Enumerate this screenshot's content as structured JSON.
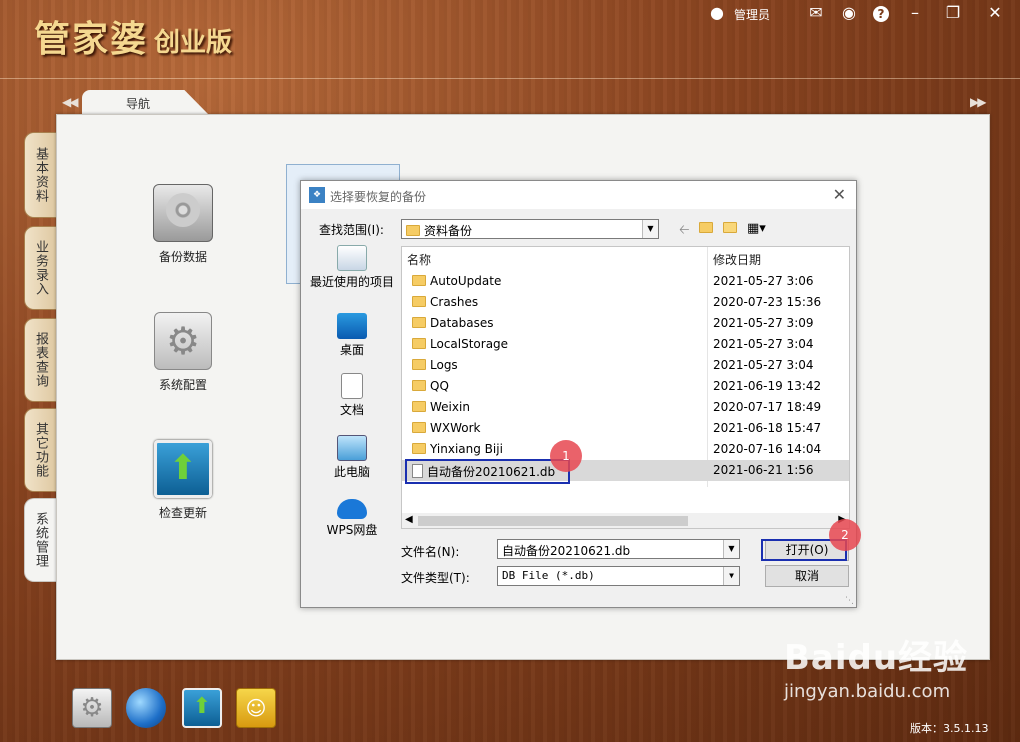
{
  "app": {
    "brand": "管家婆",
    "edition": "创业版",
    "admin_label": "管理员",
    "version": "版本：3.5.1.13"
  },
  "header_icons": [
    "user-icon",
    "mail-icon",
    "weibo-icon",
    "help-icon",
    "minimize-icon",
    "restore-icon",
    "close-icon"
  ],
  "nav_tab": "导航",
  "side_tabs": [
    "基本资料",
    "业务录入",
    "报表查询",
    "其它功能",
    "系统管理"
  ],
  "active_side_tab": "系统管理",
  "nav_items": [
    "备份数据",
    "系统配置",
    "检查更新"
  ],
  "dialog": {
    "title": "选择要恢复的备份",
    "lookin_label": "查找范围(I):",
    "lookin_value": "资料备份",
    "places": [
      "最近使用的项目",
      "桌面",
      "文档",
      "此电脑",
      "WPS网盘"
    ],
    "columns": {
      "name": "名称",
      "date": "修改日期"
    },
    "files": [
      {
        "name": "AutoUpdate",
        "date": "2021-05-27 3:06",
        "type": "folder"
      },
      {
        "name": "Crashes",
        "date": "2020-07-23 15:36",
        "type": "folder"
      },
      {
        "name": "Databases",
        "date": "2021-05-27 3:09",
        "type": "folder"
      },
      {
        "name": "LocalStorage",
        "date": "2021-05-27 3:04",
        "type": "folder"
      },
      {
        "name": "Logs",
        "date": "2021-05-27 3:04",
        "type": "folder"
      },
      {
        "name": "QQ",
        "date": "2021-06-19 13:42",
        "type": "folder"
      },
      {
        "name": "Weixin",
        "date": "2020-07-17 18:49",
        "type": "folder"
      },
      {
        "name": "WXWork",
        "date": "2021-06-18 15:47",
        "type": "folder"
      },
      {
        "name": "Yinxiang Biji",
        "date": "2020-07-16 14:04",
        "type": "folder"
      },
      {
        "name": "自动备份20210621.db",
        "date": "2021-06-21 1:56",
        "type": "file"
      }
    ],
    "selected_file": "自动备份20210621.db",
    "filename_label": "文件名(N):",
    "filename_value": "自动备份20210621.db",
    "filetype_label": "文件类型(T):",
    "filetype_value": "DB File (*.db)",
    "open_button": "打开(O)",
    "cancel_button": "取消"
  },
  "annotations": [
    "1",
    "2"
  ],
  "watermark": {
    "logo": "Baidu经验",
    "url": "jingyan.baidu.com"
  }
}
